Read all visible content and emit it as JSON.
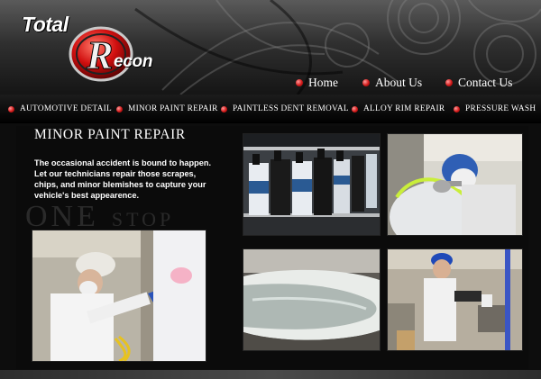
{
  "brand": {
    "logo_total": "Total",
    "logo_recon": "econ",
    "logo_r": "R"
  },
  "top_nav": [
    {
      "label": "Home"
    },
    {
      "label": "About Us"
    },
    {
      "label": "Contact Us"
    }
  ],
  "services_nav": [
    {
      "label": "AUTOMOTIVE DETAIL"
    },
    {
      "label": "MINOR PAINT REPAIR"
    },
    {
      "label": "PAINTLESS DENT REMOVAL"
    },
    {
      "label": "ALLOY RIM REPAIR"
    },
    {
      "label": "PRESSURE WASH"
    }
  ],
  "main": {
    "title": "MINOR PAINT REPAIR",
    "intro": "The occasional accident is bound to happen. Let our technicians repair those scrapes, chips, and minor blemishes to capture your vehicle's best appearence.",
    "watermark_1": "ONE",
    "watermark_2": "STOP"
  },
  "colors": {
    "accent_red": "#d21919",
    "background": "#0d0d0d",
    "text": "#ffffff"
  }
}
